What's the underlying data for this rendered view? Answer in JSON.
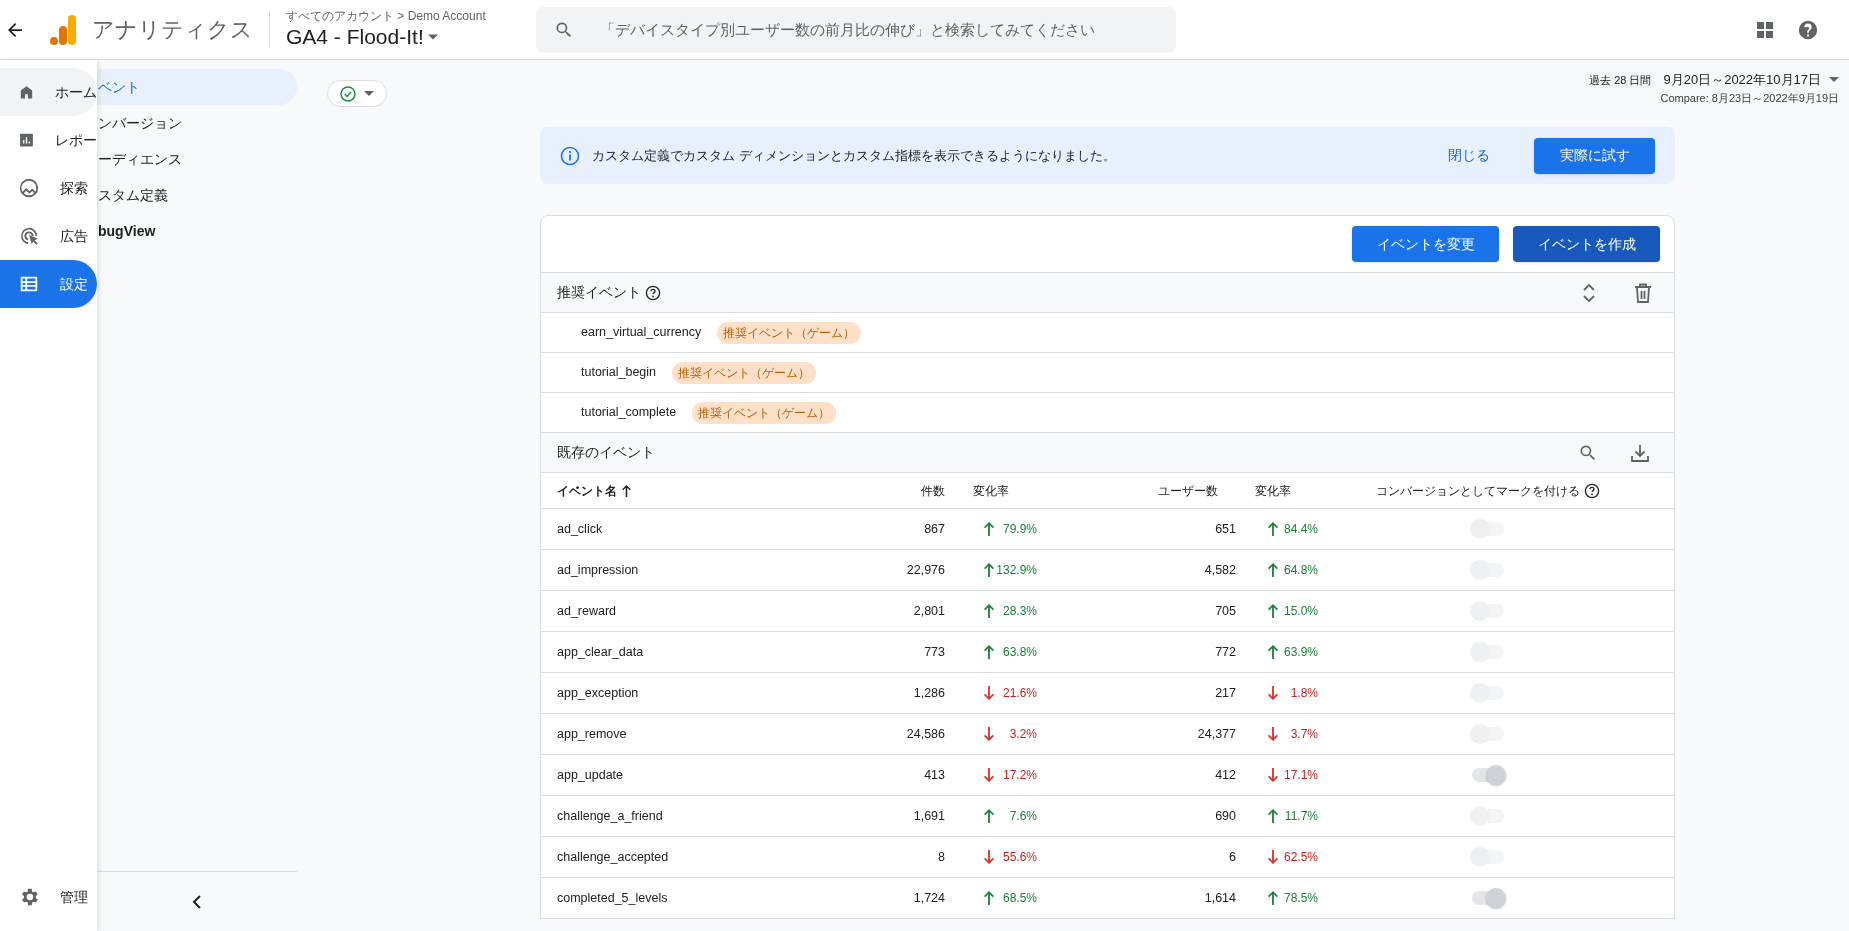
{
  "app_bar": {
    "product": "アナリティクス",
    "breadcrumb": "すべてのアカウント > Demo Account",
    "property": "GA4 - Flood-It!",
    "search": {
      "placeholder": "「デバイスタイプ別ユーザー数の前月比の伸び」と検索してみてください"
    }
  },
  "nav_rail": [
    {
      "label": "ホーム",
      "selected": false,
      "hovered": true
    },
    {
      "label": "レポー",
      "selected": false,
      "hovered": false
    },
    {
      "label": "探索",
      "selected": false,
      "hovered": false
    },
    {
      "label": "広告",
      "selected": false,
      "hovered": false
    },
    {
      "label": "設定",
      "selected": true,
      "hovered": false
    }
  ],
  "nav_admin": {
    "label": "管理"
  },
  "sub_nav": [
    {
      "label": "ベント",
      "selected": true
    },
    {
      "label": "ンバージョン",
      "selected": false
    },
    {
      "label": "ーディエンス",
      "selected": false
    },
    {
      "label": "スタム定義",
      "selected": false
    },
    {
      "label": "bugView",
      "selected": false
    }
  ],
  "date_range": {
    "preset": "過去 28 日間",
    "range": "9月20日～2022年10月17日",
    "compare": "Compare: 8月23日～2022年9月19日"
  },
  "banner": {
    "text": "カスタム定義でカスタム ディメンションとカスタム指標を表示できるようになりました。",
    "dismiss": "閉じる",
    "action": "実際に試す"
  },
  "actions": [
    {
      "label": "イベントを変更",
      "hovered": false
    },
    {
      "label": "イベントを作成",
      "hovered": true
    }
  ],
  "recommended": {
    "title": "推奨イベント",
    "rows": [
      {
        "name": "earn_virtual_currency",
        "tag": "推奨イベント（ゲーム）"
      },
      {
        "name": "tutorial_begin",
        "tag": "推奨イベント（ゲーム）"
      },
      {
        "name": "tutorial_complete",
        "tag": "推奨イベント（ゲーム）"
      }
    ]
  },
  "existing": {
    "title": "既存のイベント",
    "columns": [
      "イベント名",
      "件数",
      "変化率",
      "ユーザー数",
      "変化率",
      "コンバージョンとしてマークを付ける"
    ],
    "rows": [
      {
        "name": "ad_click",
        "count": "867",
        "count_rising": true,
        "count_change": "79.9%",
        "users": "651",
        "users_rising": true,
        "users_change": "84.4%",
        "conversion": false
      },
      {
        "name": "ad_impression",
        "count": "22,976",
        "count_rising": true,
        "count_change": "132.9%",
        "users": "4,582",
        "users_rising": true,
        "users_change": "64.8%",
        "conversion": false
      },
      {
        "name": "ad_reward",
        "count": "2,801",
        "count_rising": true,
        "count_change": "28.3%",
        "users": "705",
        "users_rising": true,
        "users_change": "15.0%",
        "conversion": false
      },
      {
        "name": "app_clear_data",
        "count": "773",
        "count_rising": true,
        "count_change": "63.8%",
        "users": "772",
        "users_rising": true,
        "users_change": "63.9%",
        "conversion": false
      },
      {
        "name": "app_exception",
        "count": "1,286",
        "count_rising": false,
        "count_change": "21.6%",
        "users": "217",
        "users_rising": false,
        "users_change": "1.8%",
        "conversion": false
      },
      {
        "name": "app_remove",
        "count": "24,586",
        "count_rising": false,
        "count_change": "3.2%",
        "users": "24,377",
        "users_rising": false,
        "users_change": "3.7%",
        "conversion": false
      },
      {
        "name": "app_update",
        "count": "413",
        "count_rising": false,
        "count_change": "17.2%",
        "users": "412",
        "users_rising": false,
        "users_change": "17.1%",
        "conversion": true
      },
      {
        "name": "challenge_a_friend",
        "count": "1,691",
        "count_rising": true,
        "count_change": "7.6%",
        "users": "690",
        "users_rising": true,
        "users_change": "11.7%",
        "conversion": false
      },
      {
        "name": "challenge_accepted",
        "count": "8",
        "count_rising": false,
        "count_change": "55.6%",
        "users": "6",
        "users_rising": false,
        "users_change": "62.5%",
        "conversion": false
      },
      {
        "name": "completed_5_levels",
        "count": "1,724",
        "count_rising": true,
        "count_change": "68.5%",
        "users": "1,614",
        "users_rising": true,
        "users_change": "78.5%",
        "conversion": true
      }
    ]
  }
}
